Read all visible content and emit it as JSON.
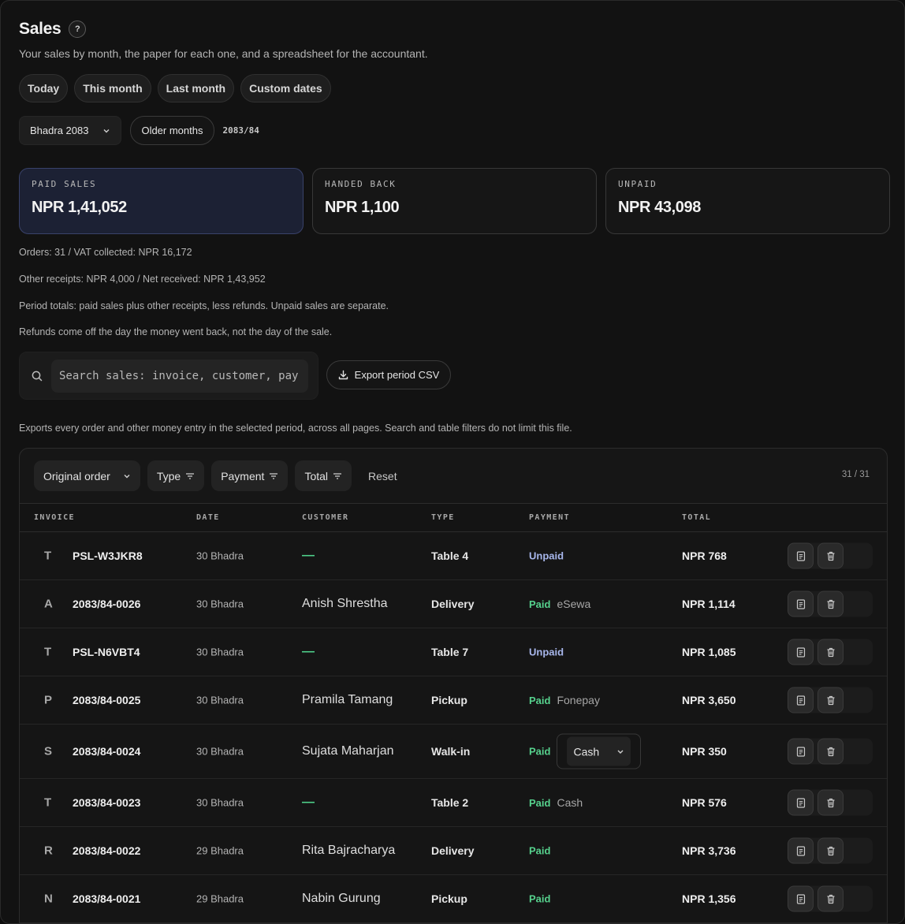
{
  "header": {
    "title": "Sales",
    "help_icon": "?",
    "subtitle": "Your sales by month, the paper for each one, and a spreadsheet for the accountant."
  },
  "quick_ranges": [
    "Today",
    "This month",
    "Last month",
    "Custom dates"
  ],
  "period": {
    "month_select": "Bhadra 2083",
    "older_label": "Older months",
    "fiscal_year": "2083/84"
  },
  "cards": [
    {
      "label": "PAID SALES",
      "value": "NPR 1,41,052"
    },
    {
      "label": "HANDED BACK",
      "value": "NPR 1,100"
    },
    {
      "label": "UNPAID",
      "value": "NPR 43,098"
    }
  ],
  "summary": {
    "line1": "Orders: 31 / VAT collected: NPR 16,172",
    "line2": "Other receipts: NPR 4,000 / Net received: NPR 1,43,952",
    "line3": "Period totals: paid sales plus other receipts, less refunds. Unpaid sales are separate.",
    "line4": "Refunds come off the day the money went back, not the day of the sale."
  },
  "search": {
    "placeholder": "Search sales: invoice, customer, pay"
  },
  "export": {
    "label": "Export period CSV",
    "note": "Exports every order and other money entry in the selected period, across all pages. Search and table filters do not limit this file."
  },
  "table": {
    "sort_select": "Original order",
    "filters": [
      "Type",
      "Payment",
      "Total"
    ],
    "reset_label": "Reset",
    "count": "31 / 31",
    "columns": [
      "INVOICE",
      "DATE",
      "CUSTOMER",
      "TYPE",
      "PAYMENT",
      "TOTAL"
    ],
    "rows": [
      {
        "letter": "T",
        "invoice": "PSL-W3JKR8",
        "date": "30 Bhadra",
        "customer": "—",
        "type": "Table 4",
        "status": "Unpaid",
        "method": "",
        "total": "NPR 768"
      },
      {
        "letter": "A",
        "invoice": "2083/84-0026",
        "date": "30 Bhadra",
        "customer": "Anish Shrestha",
        "type": "Delivery",
        "status": "Paid",
        "method": "eSewa",
        "total": "NPR 1,114"
      },
      {
        "letter": "T",
        "invoice": "PSL-N6VBT4",
        "date": "30 Bhadra",
        "customer": "—",
        "type": "Table 7",
        "status": "Unpaid",
        "method": "",
        "total": "NPR 1,085"
      },
      {
        "letter": "P",
        "invoice": "2083/84-0025",
        "date": "30 Bhadra",
        "customer": "Pramila Tamang",
        "type": "Pickup",
        "status": "Paid",
        "method": "Fonepay",
        "total": "NPR 3,650"
      },
      {
        "letter": "S",
        "invoice": "2083/84-0024",
        "date": "30 Bhadra",
        "customer": "Sujata Maharjan",
        "type": "Walk-in",
        "status": "Paid",
        "method": "Cash",
        "total": "NPR 350"
      },
      {
        "letter": "T",
        "invoice": "2083/84-0023",
        "date": "30 Bhadra",
        "customer": "—",
        "type": "Table 2",
        "status": "Paid",
        "method": "Cash",
        "total": "NPR 576"
      },
      {
        "letter": "R",
        "invoice": "2083/84-0022",
        "date": "29 Bhadra",
        "customer": "Rita Bajracharya",
        "type": "Delivery",
        "status": "Paid",
        "method": "",
        "total": "NPR 3,736"
      },
      {
        "letter": "N",
        "invoice": "2083/84-0021",
        "date": "29 Bhadra",
        "customer": "Nabin Gurung",
        "type": "Pickup",
        "status": "Paid",
        "method": "",
        "total": "NPR 1,356"
      }
    ]
  },
  "colors": {
    "paid": "#56d18d",
    "unpaid": "#a8b7ec",
    "active_card": "#1c2134"
  },
  "icons": {
    "help": "help-icon",
    "search": "search-icon",
    "export": "download-icon",
    "receipt": "receipt-icon",
    "delete": "trash-icon"
  }
}
